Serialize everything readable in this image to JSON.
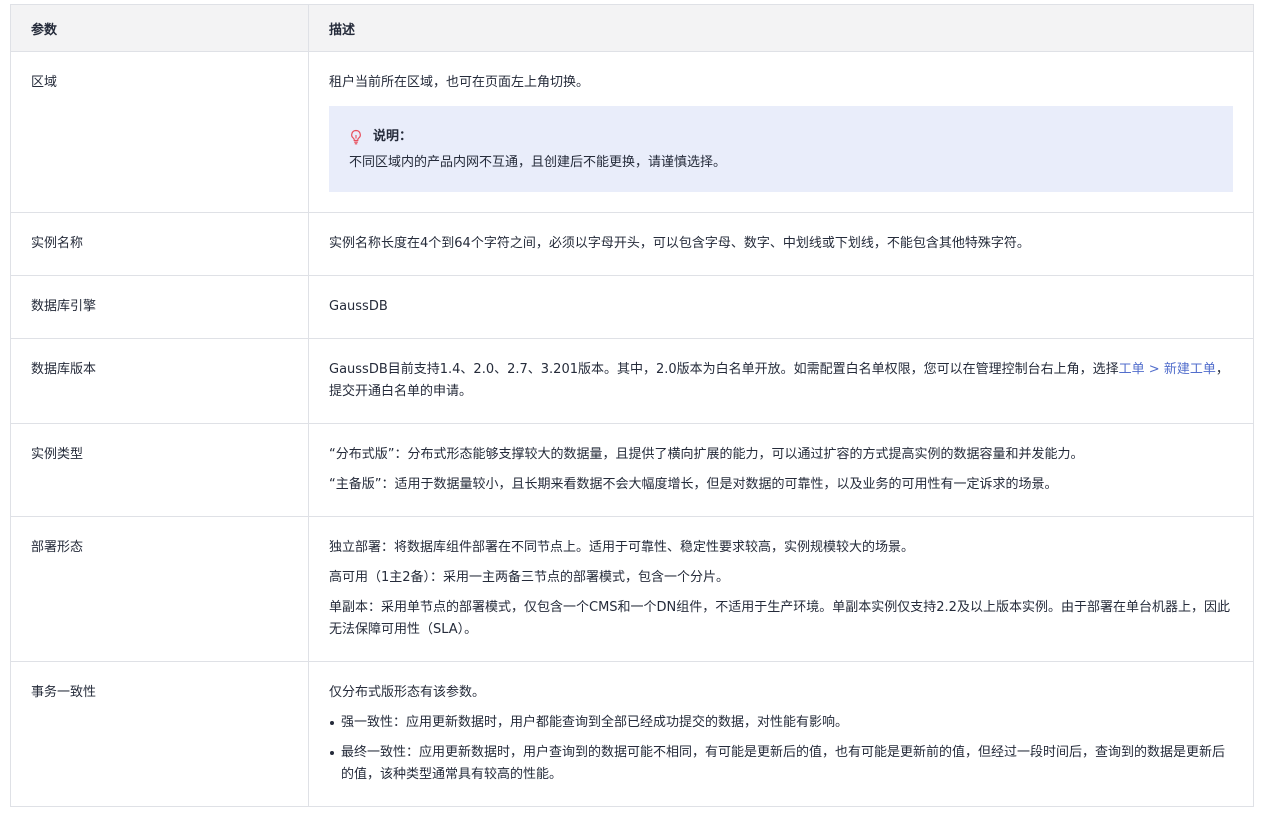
{
  "header": {
    "col_param": "参数",
    "col_desc": "描述"
  },
  "rows": [
    {
      "name": "区域",
      "desc": "租户当前所在区域，也可在页面左上角切换。",
      "note_title": "说明：",
      "note_text": "不同区域内的产品内网不互通，且创建后不能更换，请谨慎选择。"
    },
    {
      "name": "实例名称",
      "desc": "实例名称长度在4个到64个字符之间，必须以字母开头，可以包含字母、数字、中划线或下划线，不能包含其他特殊字符。"
    },
    {
      "name": "数据库引擎",
      "desc": "GaussDB"
    },
    {
      "name": "数据库版本",
      "desc_before": "GaussDB目前支持1.4、2.0、2.7、3.201版本。其中，2.0版本为白名单开放。如需配置白名单权限，您可以在管理控制台右上角，选择",
      "desc_link": "工单 > 新建工单",
      "desc_after": "，提交开通白名单的申请。"
    },
    {
      "name": "实例类型",
      "lines": [
        "“分布式版”：分布式形态能够支撑较大的数据量，且提供了横向扩展的能力，可以通过扩容的方式提高实例的数据容量和并发能力。",
        "“主备版”：适用于数据量较小，且长期来看数据不会大幅度增长，但是对数据的可靠性，以及业务的可用性有一定诉求的场景。"
      ]
    },
    {
      "name": "部署形态",
      "lines": [
        "独立部署：将数据库组件部署在不同节点上。适用于可靠性、稳定性要求较高，实例规模较大的场景。",
        "高可用（1主2备）：采用一主两备三节点的部署模式，包含一个分片。",
        "单副本：采用单节点的部署模式，仅包含一个CMS和一个DN组件，不适用于生产环境。单副本实例仅支持2.2及以上版本实例。由于部署在单台机器上，因此无法保障可用性（SLA）。"
      ]
    },
    {
      "name": "事务一致性",
      "intro": "仅分布式版形态有该参数。",
      "bullets": [
        "强一致性：应用更新数据时，用户都能查询到全部已经成功提交的数据，对性能有影响。",
        "最终一致性：应用更新数据时，用户查询到的数据可能不相同，有可能是更新后的值，也有可能是更新前的值，但经过一段时间后，查询到的数据是更新后的值，该种类型通常具有较高的性能。"
      ]
    }
  ]
}
